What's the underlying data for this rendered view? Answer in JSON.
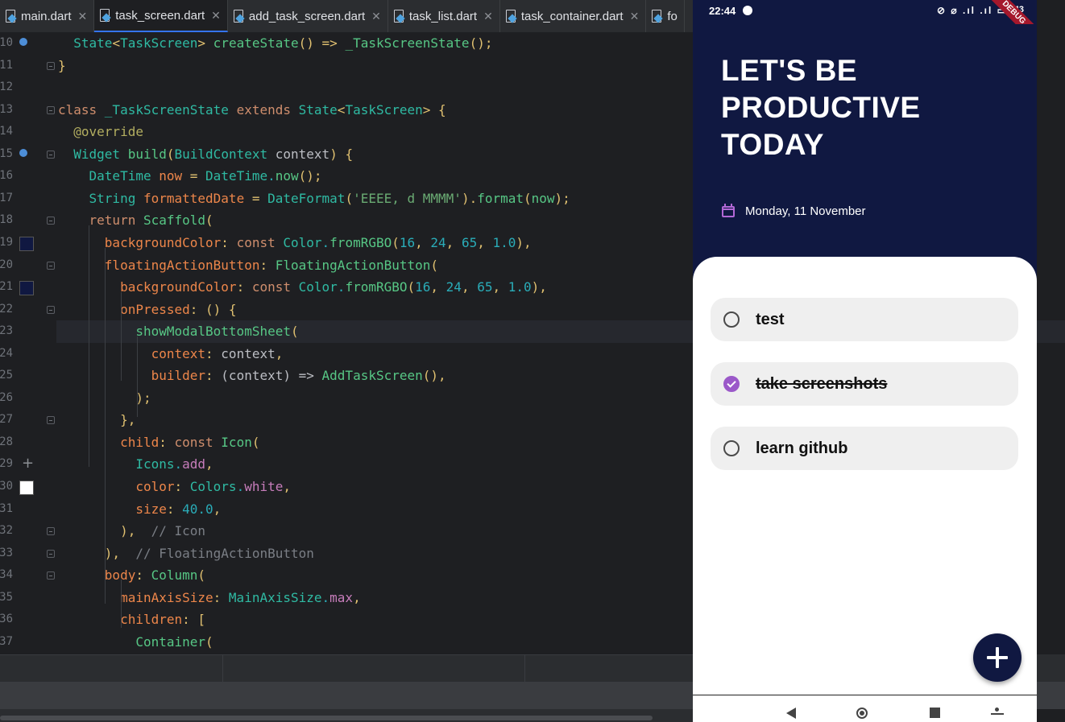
{
  "ide": {
    "tabs": [
      {
        "label": "main.dart"
      },
      {
        "label": "task_screen.dart"
      },
      {
        "label": "add_task_screen.dart"
      },
      {
        "label": "task_list.dart"
      },
      {
        "label": "task_container.dart"
      },
      {
        "label": "fo"
      }
    ],
    "line_numbers": [
      "10",
      "11",
      "12",
      "13",
      "14",
      "15",
      "16",
      "17",
      "18",
      "19",
      "20",
      "21",
      "22",
      "23",
      "24",
      "25",
      "26",
      "27",
      "28",
      "29",
      "30",
      "31",
      "32",
      "33",
      "34",
      "35",
      "36",
      "37"
    ],
    "code_lines": [
      [
        "  ",
        "State",
        "<",
        "TaskScreen",
        "> ",
        "createState",
        "() => ",
        "_TaskScreenState",
        "();"
      ],
      [
        "}"
      ],
      [
        ""
      ],
      [
        "class ",
        "_TaskScreenState ",
        "extends ",
        "State",
        "<",
        "TaskScreen",
        "> {"
      ],
      [
        "  ",
        "@override"
      ],
      [
        "  ",
        "Widget ",
        "build",
        "(",
        "BuildContext ",
        "context",
        ") {"
      ],
      [
        "    ",
        "DateTime ",
        "now",
        " = ",
        "DateTime",
        ".",
        "now",
        "();"
      ],
      [
        "    ",
        "String ",
        "formattedDate",
        " = ",
        "DateFormat",
        "(",
        "'EEEE, d MMMM'",
        ").",
        "format",
        "(",
        "now",
        ");"
      ],
      [
        "    ",
        "return ",
        "Scaffold",
        "("
      ],
      [
        "      ",
        "backgroundColor",
        ": ",
        "const ",
        "Color",
        ".",
        "fromRGBO",
        "(",
        "16",
        ", ",
        "24",
        ", ",
        "65",
        ", ",
        "1.0",
        "),"
      ],
      [
        "      ",
        "floatingActionButton",
        ": ",
        "FloatingActionButton",
        "("
      ],
      [
        "        ",
        "backgroundColor",
        ": ",
        "const ",
        "Color",
        ".",
        "fromRGBO",
        "(",
        "16",
        ", ",
        "24",
        ", ",
        "65",
        ", ",
        "1.0",
        "),"
      ],
      [
        "        ",
        "onPressed",
        ": ",
        "() {"
      ],
      [
        "          ",
        "showModalBottomSheet",
        "("
      ],
      [
        "            ",
        "context",
        ": ",
        "context",
        ","
      ],
      [
        "            ",
        "builder",
        ": ",
        "(context) => ",
        "AddTaskScreen",
        "(),"
      ],
      [
        "          ",
        ");"
      ],
      [
        "        ",
        "},"
      ],
      [
        "        ",
        "child",
        ": ",
        "const ",
        "Icon",
        "("
      ],
      [
        "          ",
        "Icons",
        ".",
        "add",
        ","
      ],
      [
        "          ",
        "color",
        ": ",
        "Colors",
        ".",
        "white",
        ","
      ],
      [
        "          ",
        "size",
        ": ",
        "40.0",
        ","
      ],
      [
        "        ",
        "),  ",
        "// Icon"
      ],
      [
        "      ",
        "),  ",
        "// FloatingActionButton"
      ],
      [
        "      ",
        "body",
        ": ",
        "Column",
        "("
      ],
      [
        "        ",
        "mainAxisSize",
        ": ",
        "MainAxisSize",
        ".",
        "max",
        ","
      ],
      [
        "        ",
        "children",
        ": ["
      ],
      [
        "          ",
        "Container",
        "("
      ]
    ],
    "colors": {
      "editor_bg": "#1e1f22",
      "keyword": "#cf8e6d",
      "type": "#2fbaa3",
      "method": "#57c785",
      "number": "#2aacb8",
      "string": "#6aab73"
    }
  },
  "phone": {
    "status": {
      "time": "22:44",
      "icons": "⊘ ⌀ .ıl .ıl ▭",
      "debug_banner": "DEBUG",
      "battery": "43"
    },
    "header": {
      "title": "LET'S BE PRODUCTIVE TODAY",
      "date": "Monday, 11 November"
    },
    "tasks": [
      {
        "label": "test",
        "done": false
      },
      {
        "label": "take screenshots",
        "done": true
      },
      {
        "label": "learn github",
        "done": false
      }
    ],
    "colors": {
      "header_bg": "#101841",
      "accent": "#9b59c9",
      "task_bg": "#efefef"
    },
    "icons": {
      "fab": "add-icon",
      "calendar": "calendar-icon",
      "nav": [
        "back-icon",
        "home-icon",
        "recents-icon",
        "accessibility-icon"
      ]
    }
  }
}
